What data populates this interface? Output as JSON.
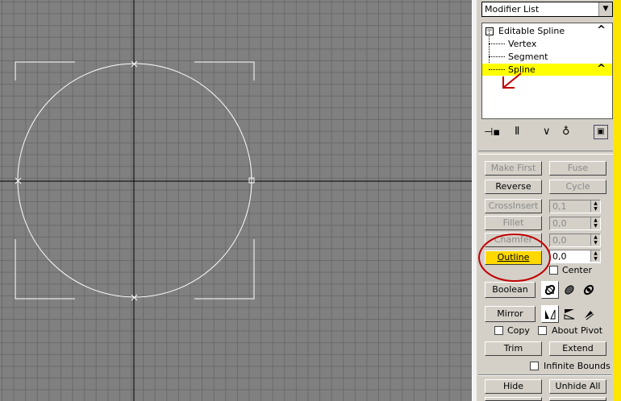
{
  "modifier_list": {
    "label": "Modifier List"
  },
  "stack": {
    "root": "Editable Spline",
    "items": [
      "Vertex",
      "Segment",
      "Spline"
    ],
    "selected": "Spline"
  },
  "geometry": {
    "make_first": "Make First",
    "fuse": "Fuse",
    "reverse": "Reverse",
    "cycle": "Cycle",
    "crossinsert": "CrossInsert",
    "crossinsert_value": "0,1",
    "fillet": "Fillet",
    "fillet_value": "0,0",
    "chamfer": "Chamfer",
    "chamfer_value": "0,0",
    "outline": "Outline",
    "outline_value": "0,0",
    "center": "Center",
    "boolean": "Boolean",
    "mirror": "Mirror",
    "copy": "Copy",
    "about_pivot": "About Pivot",
    "trim": "Trim",
    "extend": "Extend",
    "infinite_bounds": "Infinite Bounds",
    "hide": "Hide",
    "unhide_all": "Unhide All"
  },
  "colors": {
    "accent": "#ffff00",
    "annotation": "#c00000",
    "outline_button": "#ffd800"
  }
}
